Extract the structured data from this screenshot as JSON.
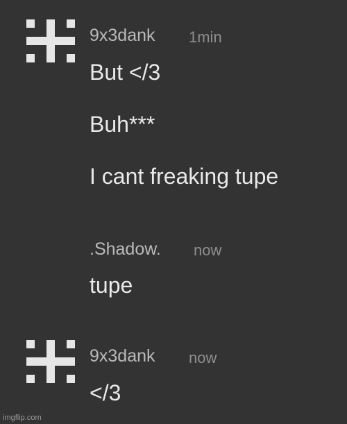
{
  "messages": [
    {
      "username": "9x3dank",
      "timestamp": "1min",
      "avatar": "pixel-hash-avatar-icon",
      "lines": [
        "But </3",
        "Buh***",
        "I cant freaking tupe"
      ]
    },
    {
      "username": ".Shadow.",
      "timestamp": "now",
      "lines": [
        "tupe"
      ]
    },
    {
      "username": "9x3dank",
      "timestamp": "now",
      "avatar": "pixel-hash-avatar-icon",
      "lines": [
        "</3"
      ]
    }
  ],
  "watermark": "imgflip.com",
  "colors": {
    "background": "#333333",
    "username": "#b9b9b9",
    "timestamp": "#8e8e8e",
    "message": "#e9e9e9",
    "avatar": "#e6e6e6"
  }
}
